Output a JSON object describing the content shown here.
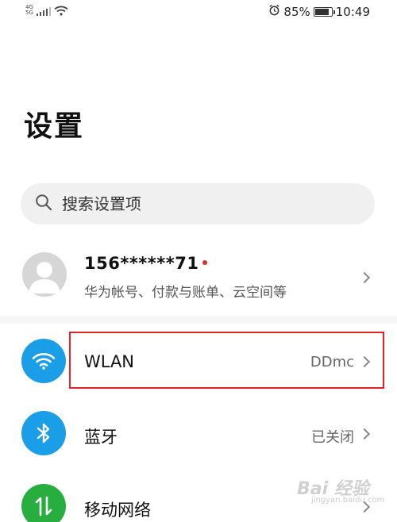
{
  "status_bar": {
    "network_type": "4G",
    "network_sub": "5G",
    "alarm_icon": "alarm-clock-icon",
    "battery": "85%",
    "battery_level": 0.85,
    "time": "10:49"
  },
  "page": {
    "title": "设置"
  },
  "search": {
    "placeholder": "搜索设置项",
    "icon": "search-icon"
  },
  "account": {
    "name": "156******71",
    "subtitle": "华为帐号、付款与账单、云空间等",
    "has_notification_dot": true
  },
  "settings": [
    {
      "label": "WLAN",
      "value": "DDmc",
      "icon": "wifi-icon",
      "icon_color": "#1a9ee8"
    },
    {
      "label": "蓝牙",
      "value": "已关闭",
      "icon": "bluetooth-icon",
      "icon_color": "#1a9ee8"
    },
    {
      "label": "移动网络",
      "value": "",
      "icon": "mobile-data-icon",
      "icon_color": "#27ae3e"
    }
  ],
  "watermark": {
    "text": "Bai 经验",
    "sub": "jingyan.baidu.com"
  },
  "colors": {
    "highlight_border": "#e3222a",
    "notification_dot": "#e02e24"
  }
}
